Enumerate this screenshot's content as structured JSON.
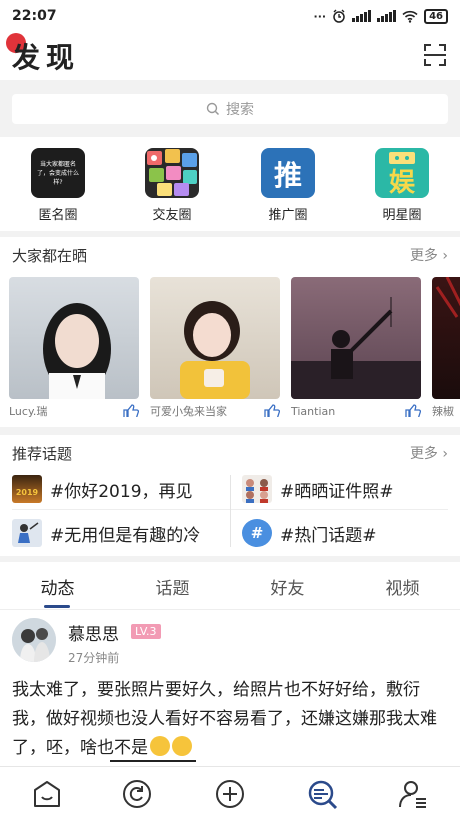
{
  "status_bar": {
    "time": "22:07",
    "dots": "···",
    "battery": "46"
  },
  "header": {
    "title": "发现"
  },
  "search": {
    "placeholder": "搜索"
  },
  "circles": [
    {
      "label": "匿名圈",
      "icon": "anonymous-circle-icon",
      "icon_text": "当大家都匿名了，会变成什么样?"
    },
    {
      "label": "交友圈",
      "icon": "dating-circle-icon"
    },
    {
      "label": "推广圈",
      "icon": "promotion-circle-icon",
      "icon_text": "推"
    },
    {
      "label": "明星圈",
      "icon": "celebrity-circle-icon",
      "icon_text": "娱"
    }
  ],
  "showcase": {
    "title": "大家都在晒",
    "more": "更多",
    "cards": [
      {
        "user": "Lucy.瑞"
      },
      {
        "user": "可爱小兔来当家"
      },
      {
        "user": "Tiantian"
      },
      {
        "user": "辣椒"
      }
    ]
  },
  "topics": {
    "title": "推荐话题",
    "more": "更多",
    "items": [
      {
        "label": "#你好2019，再见",
        "thumb_text": "2019"
      },
      {
        "label": "#晒晒证件照#"
      },
      {
        "label": "#无用但是有趣的冷"
      },
      {
        "label": "#热门话题#",
        "thumb_text": "#"
      }
    ]
  },
  "tabs": [
    "动态",
    "话题",
    "好友",
    "视频"
  ],
  "post": {
    "name": "慕思思",
    "level": "LV.3",
    "time": "27分钟前",
    "body": "我太难了，要张照片要好久，给照片也不好好给，敷衍我，做好视频也没人看好不容易看了，还嫌这嫌那我太难了，呸，啥也不是"
  },
  "colors": {
    "accent": "#2b4a8b",
    "red_dot": "#e0333a",
    "level_badge": "#f29bb4"
  }
}
